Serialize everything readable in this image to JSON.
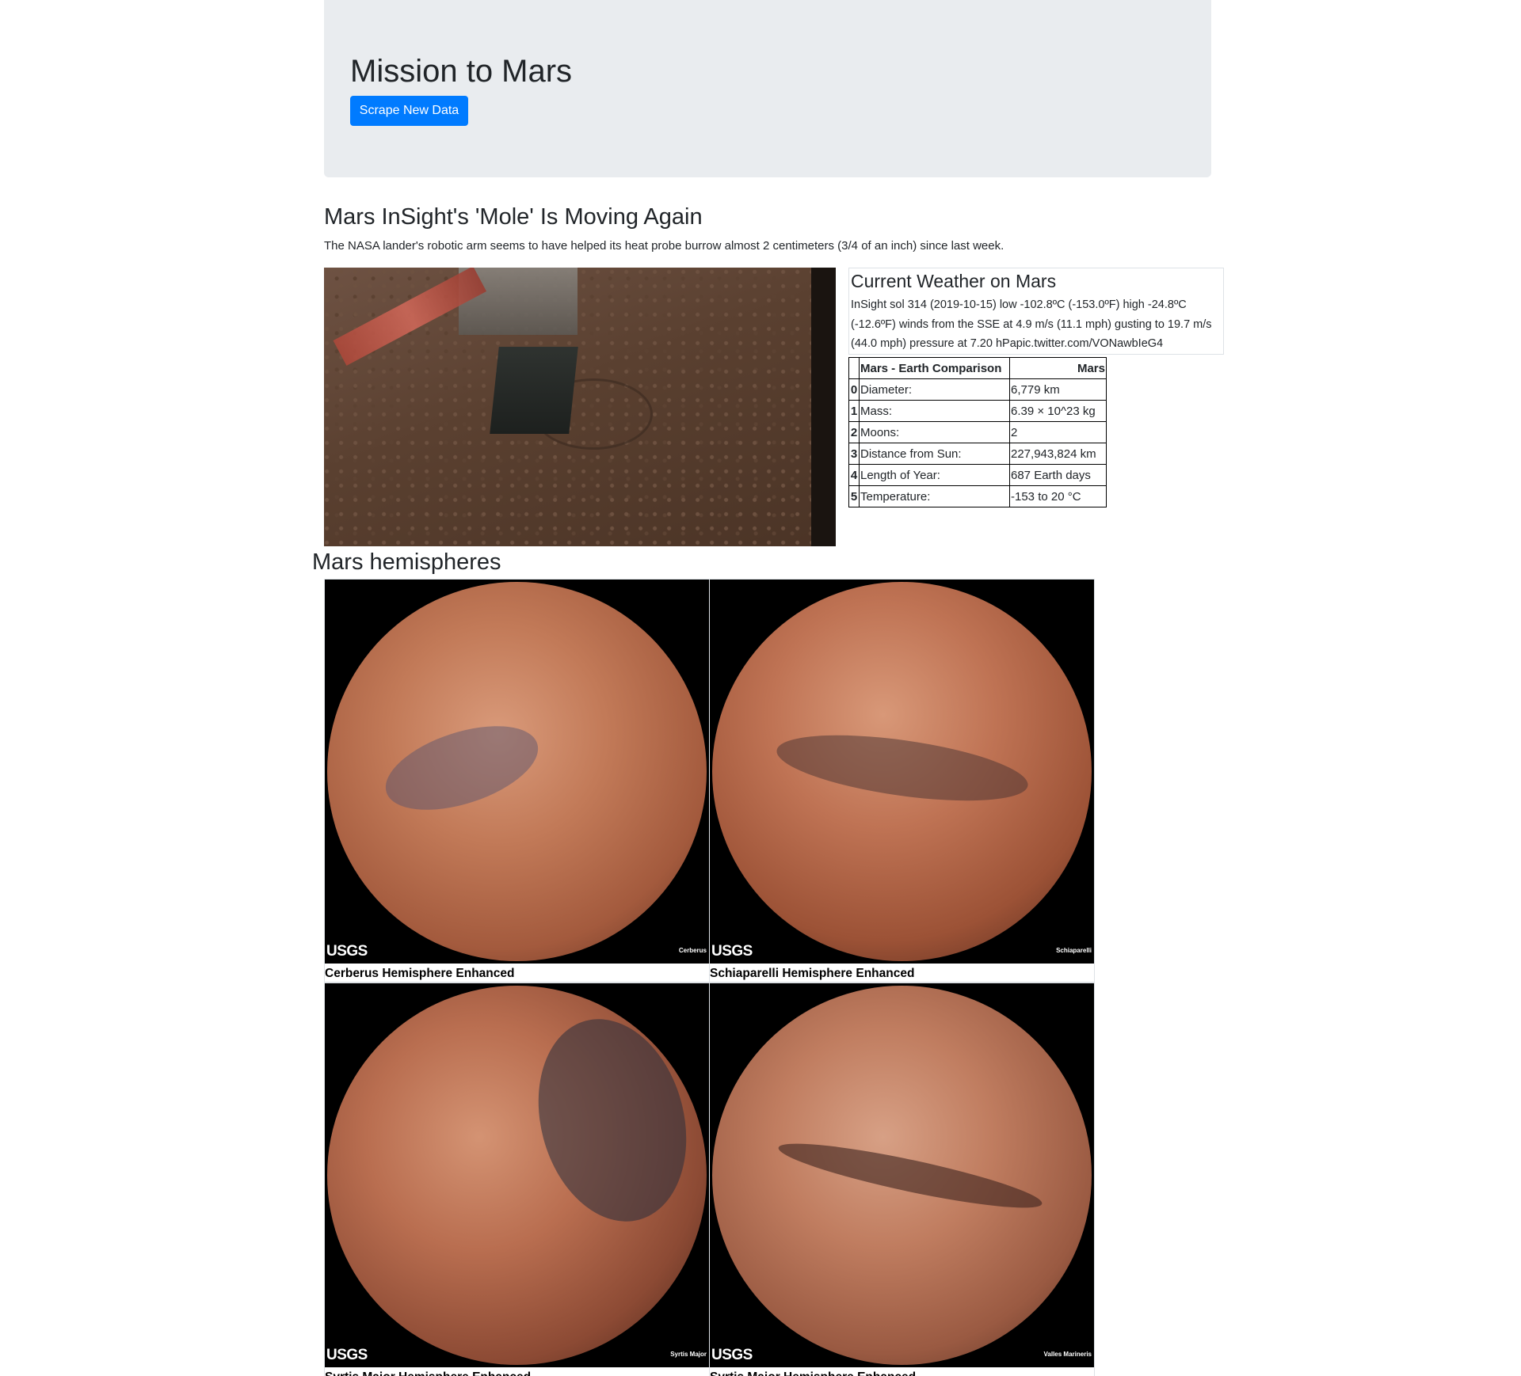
{
  "header": {
    "title": "Mission to Mars",
    "scrape_button_label": "Scrape New Data"
  },
  "news": {
    "title": "Mars InSight's 'Mole' Is Moving Again",
    "teaser": "The NASA lander's robotic arm seems to have helped its heat probe burrow almost 2 centimeters (3/4 of an inch) since last week."
  },
  "weather": {
    "heading": "Current Weather on Mars",
    "text": "InSight sol 314 (2019-10-15) low -102.8ºC (-153.0ºF) high -24.8ºC (-12.6ºF) winds from the SSE at 4.9 m/s (11.1 mph) gusting to 19.7 m/s (44.0 mph) pressure at 7.20 hPapic.twitter.com/VONawbIeG4"
  },
  "facts": {
    "headers": [
      "",
      "Mars - Earth Comparison",
      "Mars"
    ],
    "rows": [
      {
        "index": "0",
        "label": "Diameter:",
        "value": "6,779 km"
      },
      {
        "index": "1",
        "label": "Mass:",
        "value": "6.39 × 10^23 kg"
      },
      {
        "index": "2",
        "label": "Moons:",
        "value": "2"
      },
      {
        "index": "3",
        "label": "Distance from Sun:",
        "value": "227,943,824 km"
      },
      {
        "index": "4",
        "label": "Length of Year:",
        "value": "687 Earth days"
      },
      {
        "index": "5",
        "label": "Temperature:",
        "value": "-153 to 20 °C"
      }
    ]
  },
  "hemispheres": {
    "heading": "Mars hemispheres",
    "items": [
      {
        "caption": "Cerberus Hemisphere Enhanced",
        "logo": "USGS",
        "tag": "Cerberus"
      },
      {
        "caption": "Schiaparelli Hemisphere Enhanced",
        "logo": "USGS",
        "tag": "Schiaparelli"
      },
      {
        "caption": "Syrtis Major Hemisphere Enhanced",
        "logo": "USGS",
        "tag": "Syrtis Major"
      },
      {
        "caption": "Syrtis Major Hemisphere Enhanced",
        "logo": "USGS",
        "tag": "Valles Marineris"
      }
    ]
  },
  "colors": {
    "jumbotron_bg": "#e9ecef",
    "primary_button": "#007bff"
  }
}
